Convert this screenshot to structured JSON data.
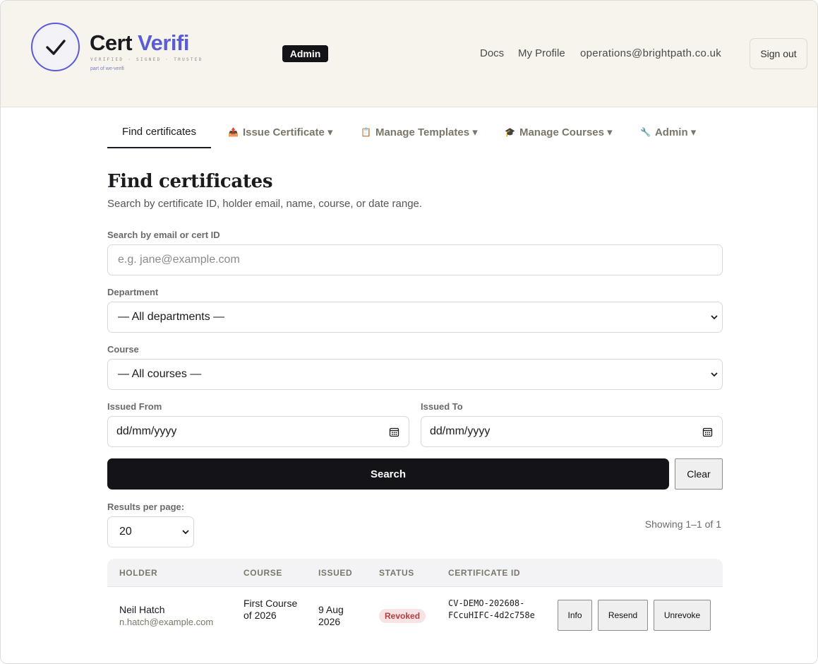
{
  "header": {
    "brand_part1": "Cert",
    "brand_part2": "Verifi",
    "tagline": "VERIFIED · SIGNED · TRUSTED",
    "part_of": "part of we-verifi",
    "role_badge": "Admin",
    "links": {
      "docs": "Docs",
      "profile": "My Profile",
      "email": "operations@brightpath.co.uk"
    },
    "signout": "Sign out"
  },
  "tabs": [
    {
      "label": "Find certificates",
      "icon": "",
      "active": true
    },
    {
      "label": "Issue Certificate ▾",
      "icon": "📤"
    },
    {
      "label": "Manage Templates ▾",
      "icon": "📋"
    },
    {
      "label": "Manage Courses ▾",
      "icon": "🎓"
    },
    {
      "label": "Admin ▾",
      "icon": "🔧"
    }
  ],
  "page": {
    "title": "Find certificates",
    "subtitle": "Search by certificate ID, holder email, name, course, or date range."
  },
  "form": {
    "search_label": "Search by email or cert ID",
    "search_placeholder": "e.g. jane@example.com",
    "department_label": "Department",
    "department_value": "— All departments —",
    "course_label": "Course",
    "course_value": "— All courses —",
    "from_label": "Issued From",
    "from_value": "dd/mm/yyyy",
    "to_label": "Issued To",
    "to_value": "dd/mm/yyyy",
    "search_button": "Search",
    "clear_button": "Clear",
    "per_page_label": "Results per page:",
    "per_page_value": "20",
    "showing": "Showing 1–1 of 1"
  },
  "table": {
    "headers": [
      "HOLDER",
      "COURSE",
      "ISSUED",
      "STATUS",
      "CERTIFICATE ID"
    ],
    "rows": [
      {
        "name": "Neil Hatch",
        "email": "n.hatch@example.com",
        "course": "First Course of 2026",
        "issued": "9 Aug 2026",
        "status": "Revoked",
        "cert_id": "CV-DEMO-202608-FCcuHIFC-4d2c758e",
        "actions": [
          "Info",
          "Resend",
          "Unrevoke"
        ]
      }
    ]
  },
  "colors": {
    "accent": "#5b5bd6",
    "header_bg": "#f6f4ec",
    "primary_button": "#131318",
    "revoked": "#b34040"
  }
}
